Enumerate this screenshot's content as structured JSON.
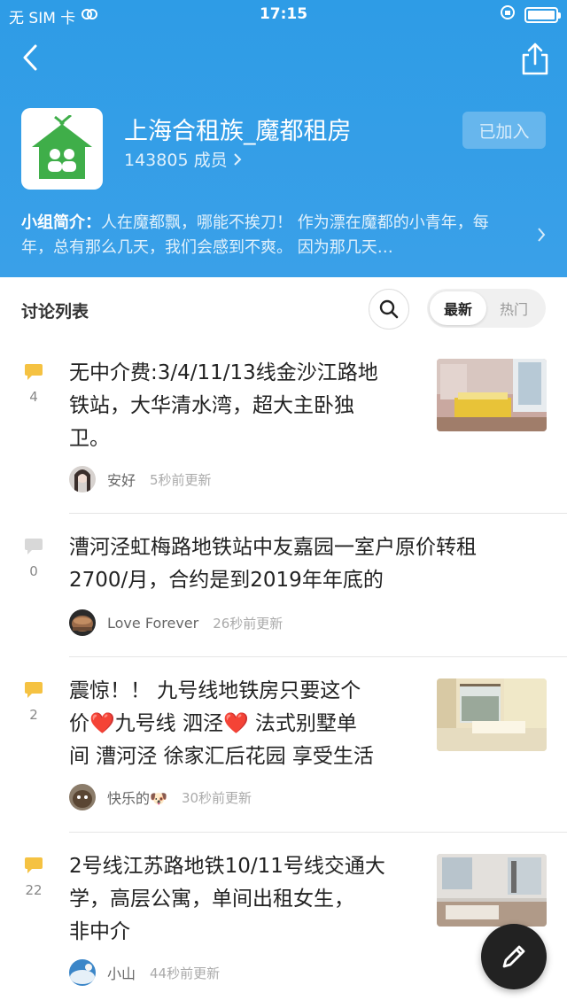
{
  "status_bar": {
    "carrier": "无 SIM 卡",
    "time": "17:15"
  },
  "group": {
    "name": "上海合租族_魔都租房",
    "members": "143805 成员",
    "join_status": "已加入",
    "intro_label": "小组简介：",
    "intro_text": "人在魔都飘，哪能不挨刀！ 作为漂在魔都的小青年，每年，总有那么几天，我们会感到不爽。 因为那几天…"
  },
  "discussion": {
    "title": "讨论列表",
    "sort_options": [
      "最新",
      "热门"
    ],
    "selected_sort": "最新"
  },
  "posts": [
    {
      "title_lines": [
        "无中介费:3/4/11/13线金沙江路地",
        "铁站，大华清水湾，超大主卧独",
        "卫。"
      ],
      "replies": "4",
      "author": "安好",
      "updated": "5秒前更新",
      "has_thumbnail": true
    },
    {
      "title_lines": [
        "漕河泾虹梅路地铁站中友嘉园一室户原价转租",
        "2700/月，合约是到2019年年底的"
      ],
      "replies": "0",
      "author": "Love Forever",
      "updated": "26秒前更新",
      "has_thumbnail": false
    },
    {
      "title_lines": [
        "震惊！！ 九号线地铁房只要这个",
        "价❤️九号线 泗泾❤️ 法式别墅单",
        "间 漕河泾 徐家汇后花园 享受生活"
      ],
      "replies": "2",
      "author": "快乐的🐶",
      "updated": "30秒前更新",
      "has_thumbnail": true
    },
    {
      "title_lines": [
        "2号线江苏路地铁10/11号线交通大",
        "学，高层公寓，单间出租女生，",
        "非中介"
      ],
      "replies": "22",
      "author": "小山",
      "updated": "44秒前更新",
      "has_thumbnail": true
    }
  ],
  "colors": {
    "header_blue": "#2e9ce6",
    "logo_green": "#3fae49",
    "bubble_active": "#f5c242",
    "bubble_inactive": "#d8d8d8"
  },
  "icons": {
    "back": "chevron-left-icon",
    "share": "share-icon",
    "search": "search-icon",
    "compose": "pen-icon"
  }
}
